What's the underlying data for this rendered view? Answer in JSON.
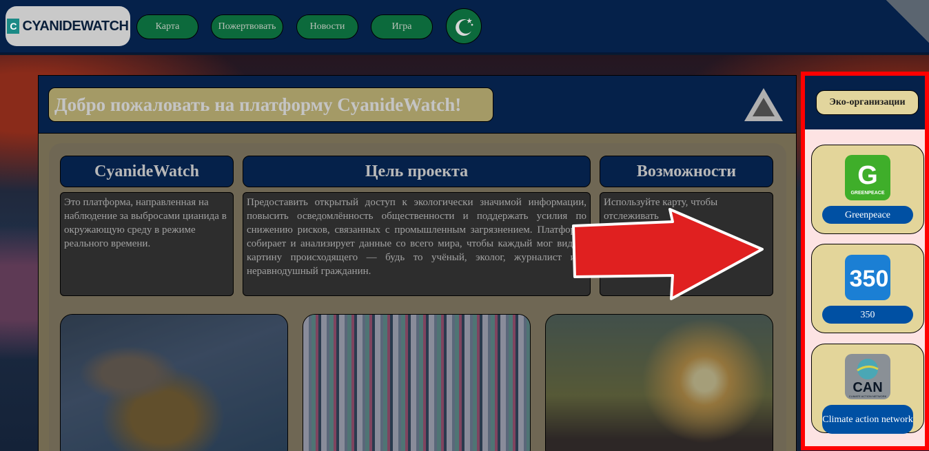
{
  "header": {
    "logo_text": "CYANIDEWATCH",
    "logo_mark": "C",
    "nav": [
      {
        "label": "Карта"
      },
      {
        "label": "Пожертвовать"
      },
      {
        "label": "Новости"
      },
      {
        "label": "Игра"
      }
    ],
    "theme_icon": "moon-star-icon"
  },
  "main": {
    "welcome": "Добро пожаловать на платформу CyanideWatch!",
    "scroll_icon": "triangle-up-icon",
    "columns": [
      {
        "title": "CyanideWatch",
        "text": "Это платформа, направленная на наблюдение за выбросами цианида в окружающую среду в режиме реального времени."
      },
      {
        "title": "Цель проекта",
        "text": "Предоставить открытый доступ к экологически значимой информации, повысить осведомлённость общественности и поддержать усилия по снижению рисков, связанных с промышленным загрязнением. Платформа собирает и анализирует данные со всего мира, чтобы каждый мог видеть картину происходящего — будь то учёный, эколог, журналист или неравнодушный гражданин."
      },
      {
        "title": "Возможности",
        "text": "Используйте карту, чтобы отслеживать"
      }
    ],
    "photos": [
      "industrial-pipe-discharge-photo",
      "lab-test-tubes-photo",
      "hands-water-seedling-photo"
    ]
  },
  "sidebar": {
    "title": "Эко-организации",
    "orgs": [
      {
        "name": "Greenpeace",
        "logo_letter": "G",
        "logo_caption": "GREENPEACE",
        "logo_color": "#3fae2a"
      },
      {
        "name": "350",
        "logo_text": "350",
        "logo_color": "#1b7fd4"
      },
      {
        "name": "Climate action network",
        "logo_text": "CAN",
        "logo_caption": "CLIMATE ACTION NETWORK",
        "logo_color": "#8a9096"
      }
    ]
  },
  "colors": {
    "navy": "#05214a",
    "nav_green": "#0c6a3c",
    "gold": "#e3d59a",
    "highlight_red": "#ff0000",
    "org_blue": "#0050a3"
  }
}
